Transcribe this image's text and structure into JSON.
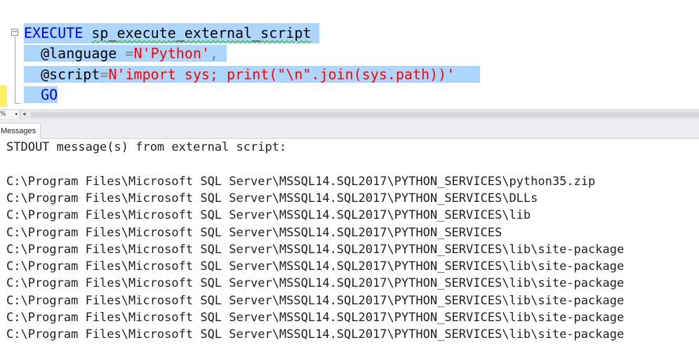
{
  "editor": {
    "fold_symbol": "−",
    "lines": [
      {
        "keyword": "EXECUTE",
        "proc": "sp_execute_external_script"
      },
      {
        "param": "@language",
        "op": " =",
        "value": "N'Python'",
        "trail": ","
      },
      {
        "param": "@script",
        "op": "=",
        "value": "N'import sys; print(\"\\n\".join(sys.path))'"
      },
      {
        "keyword": "GO"
      }
    ]
  },
  "toolbar": {
    "zoom_value": "%",
    "zoom_arrow": "▾",
    "scroll_left_icon": "◂"
  },
  "tabs": [
    {
      "label": "Messages"
    }
  ],
  "messages": {
    "lines": [
      "STDOUT message(s) from external script:",
      "",
      "C:\\Program Files\\Microsoft SQL Server\\MSSQL14.SQL2017\\PYTHON_SERVICES\\python35.zip",
      "C:\\Program Files\\Microsoft SQL Server\\MSSQL14.SQL2017\\PYTHON_SERVICES\\DLLs",
      "C:\\Program Files\\Microsoft SQL Server\\MSSQL14.SQL2017\\PYTHON_SERVICES\\lib",
      "C:\\Program Files\\Microsoft SQL Server\\MSSQL14.SQL2017\\PYTHON_SERVICES",
      "C:\\Program Files\\Microsoft SQL Server\\MSSQL14.SQL2017\\PYTHON_SERVICES\\lib\\site-package",
      "C:\\Program Files\\Microsoft SQL Server\\MSSQL14.SQL2017\\PYTHON_SERVICES\\lib\\site-package",
      "C:\\Program Files\\Microsoft SQL Server\\MSSQL14.SQL2017\\PYTHON_SERVICES\\lib\\site-package",
      "C:\\Program Files\\Microsoft SQL Server\\MSSQL14.SQL2017\\PYTHON_SERVICES\\lib\\site-package",
      "C:\\Program Files\\Microsoft SQL Server\\MSSQL14.SQL2017\\PYTHON_SERVICES\\lib\\site-package",
      "C:\\Program Files\\Microsoft SQL Server\\MSSQL14.SQL2017\\PYTHON_SERVICES\\lib\\site-package"
    ]
  },
  "colors": {
    "keyword": "#0000ff",
    "string": "#ff0000",
    "operator": "#808080",
    "selection": "#add6ff",
    "change_marker": "#ffee62",
    "squiggle": "#14a014"
  }
}
